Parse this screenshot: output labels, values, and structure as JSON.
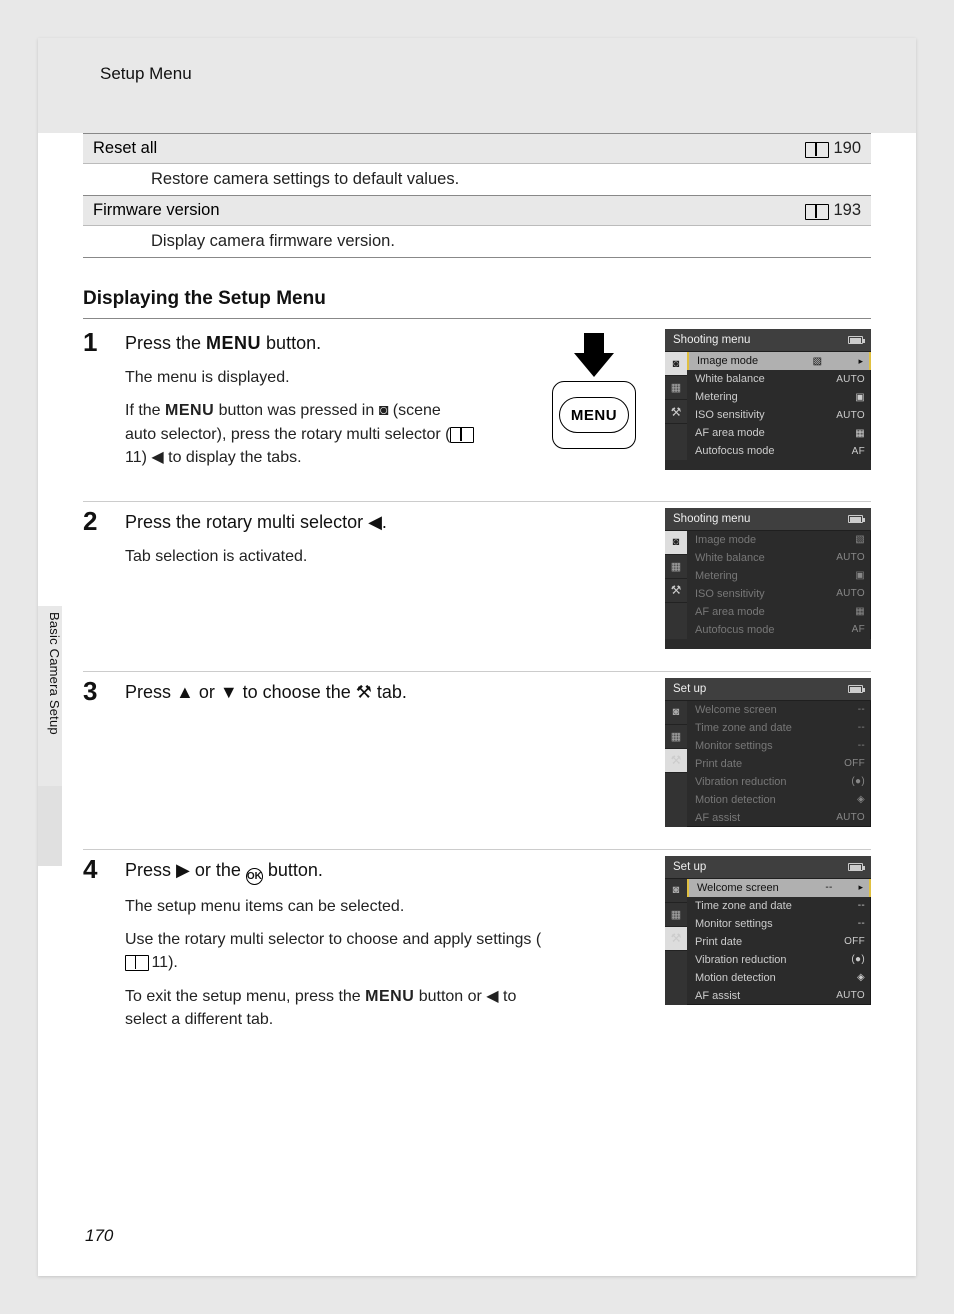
{
  "header": "Setup Menu",
  "side_tab": "Basic Camera Setup",
  "page_number": "170",
  "table": {
    "row1_label": "Reset all",
    "row1_page": "190",
    "row1_desc": "Restore camera settings to default values.",
    "row2_label": "Firmware version",
    "row2_page": "193",
    "row2_desc": "Display camera firmware version."
  },
  "section_heading": "Displaying the Setup Menu",
  "steps": {
    "s1": {
      "num": "1",
      "title_a": "Press the ",
      "title_menu": "MENU",
      "title_b": " button.",
      "p1": "The menu is displayed.",
      "p2a": "If the ",
      "p2menu": "MENU",
      "p2b": " button was pressed in ",
      "p2scene": "◙",
      "p2c": " (scene auto selector), press the rotary multi selector (",
      "p2book": "",
      "p2page": "11",
      "p2d": ") ◀ to display the tabs.",
      "menu_btn": "MENU"
    },
    "s2": {
      "num": "2",
      "title": "Press the rotary multi selector ◀.",
      "p1": "Tab selection is activated."
    },
    "s3": {
      "num": "3",
      "title": "Press ▲ or ▼ to choose the ⚒ tab."
    },
    "s4": {
      "num": "4",
      "title_a": "Press ▶ or the ",
      "title_ok": "OK",
      "title_b": " button.",
      "p1": "The setup menu items can be selected.",
      "p2a": "Use the rotary multi selector to choose and apply settings (",
      "p2page": "11",
      "p2b": ").",
      "p3a": "To exit the setup menu, press the ",
      "p3menu": "MENU",
      "p3b": " button or ◀ to select a different tab."
    }
  },
  "cam": {
    "shooting_title": "Shooting menu",
    "setup_title": "Set up",
    "shooting_rows": [
      {
        "name": "Image mode",
        "val": "▧"
      },
      {
        "name": "White balance",
        "val": "AUTO"
      },
      {
        "name": "Metering",
        "val": "▣"
      },
      {
        "name": "ISO sensitivity",
        "val": "AUTO"
      },
      {
        "name": "AF area mode",
        "val": "▦"
      },
      {
        "name": "Autofocus mode",
        "val": "AF"
      }
    ],
    "setup_rows": [
      {
        "name": "Welcome screen",
        "val": "--"
      },
      {
        "name": "Time zone and date",
        "val": "--"
      },
      {
        "name": "Monitor settings",
        "val": "--"
      },
      {
        "name": "Print date",
        "val": "OFF"
      },
      {
        "name": "Vibration reduction",
        "val": "(●)"
      },
      {
        "name": "Motion detection",
        "val": "◈"
      },
      {
        "name": "AF assist",
        "val": "AUTO"
      }
    ]
  }
}
